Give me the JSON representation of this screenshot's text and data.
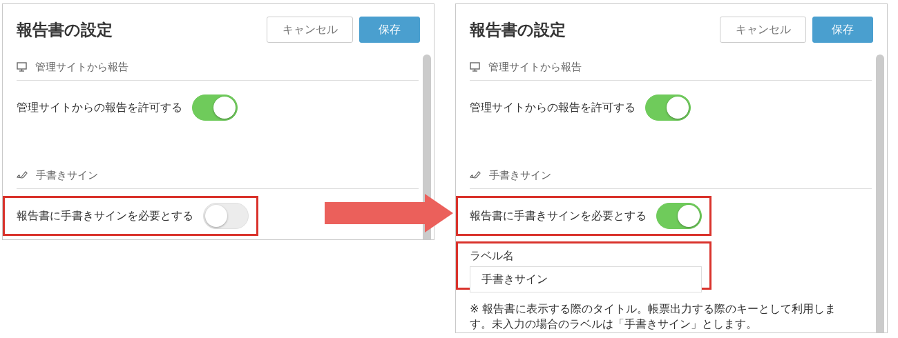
{
  "panels": [
    {
      "title": "報告書の設定",
      "cancel_button": "キャンセル",
      "save_button": "保存",
      "sections": [
        {
          "heading": "管理サイトから報告",
          "kind": "monitor",
          "items": [
            {
              "kind": "toggle",
              "label": "管理サイトからの報告を許可する",
              "on": true,
              "highlighted": false
            }
          ]
        },
        {
          "heading": "手書きサイン",
          "kind": "signature",
          "items": [
            {
              "kind": "toggle",
              "label": "報告書に手書きサインを必要とする",
              "on": false,
              "highlighted": true
            }
          ]
        }
      ]
    },
    {
      "title": "報告書の設定",
      "cancel_button": "キャンセル",
      "save_button": "保存",
      "sections": [
        {
          "heading": "管理サイトから報告",
          "kind": "monitor",
          "items": [
            {
              "kind": "toggle",
              "label": "管理サイトからの報告を許可する",
              "on": true,
              "highlighted": false
            }
          ]
        },
        {
          "heading": "手書きサイン",
          "kind": "signature",
          "items": [
            {
              "kind": "toggle",
              "label": "報告書に手書きサインを必要とする",
              "on": true,
              "highlighted": true
            },
            {
              "kind": "field",
              "label": "ラベル名",
              "value": "手書きサイン",
              "highlighted": true
            },
            {
              "kind": "note",
              "text": "※ 報告書に表示する際のタイトル。帳票出力する際のキーとして利用します。未入力の場合のラベルは「手書きサイン」とします。"
            }
          ]
        }
      ]
    }
  ]
}
